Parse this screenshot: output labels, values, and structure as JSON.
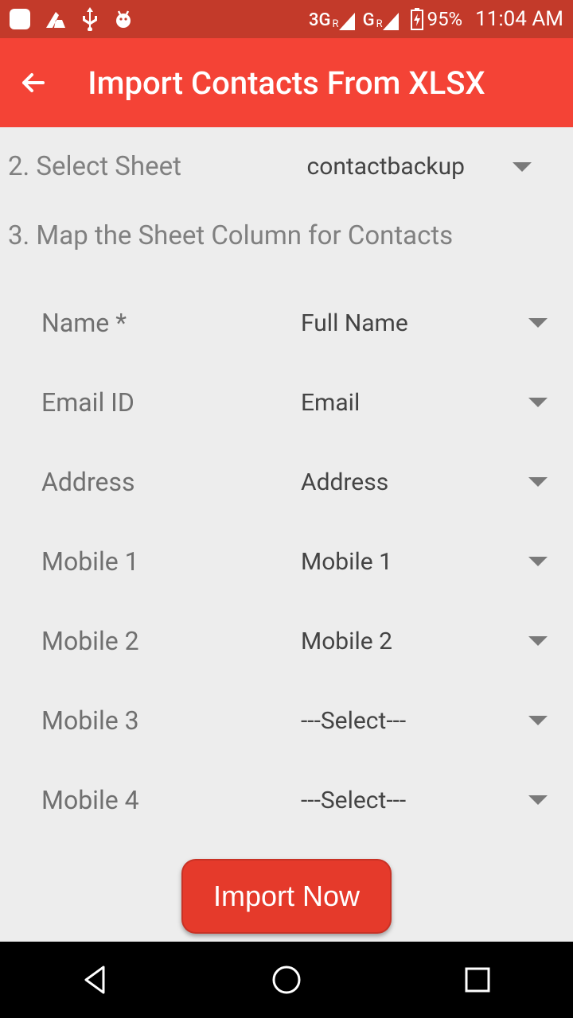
{
  "status": {
    "network1_label": "3G",
    "network1_sup": "R",
    "network2_label": "G",
    "network2_sup": "R",
    "battery_pct": "95%",
    "time": "11:04 AM"
  },
  "header": {
    "title": "Import Contacts From XLSX"
  },
  "step2": {
    "label": "2. Select Sheet",
    "selected": "contactbackup"
  },
  "step3": {
    "heading": "3. Map the Sheet Column for Contacts",
    "rows": [
      {
        "label": "Name *",
        "value": "Full Name"
      },
      {
        "label": "Email ID",
        "value": "Email"
      },
      {
        "label": "Address",
        "value": "Address"
      },
      {
        "label": "Mobile 1",
        "value": "Mobile 1"
      },
      {
        "label": "Mobile 2",
        "value": "Mobile 2"
      },
      {
        "label": "Mobile 3",
        "value": "---Select---"
      },
      {
        "label": "Mobile 4",
        "value": "---Select---"
      }
    ]
  },
  "actions": {
    "import_label": "Import Now"
  }
}
